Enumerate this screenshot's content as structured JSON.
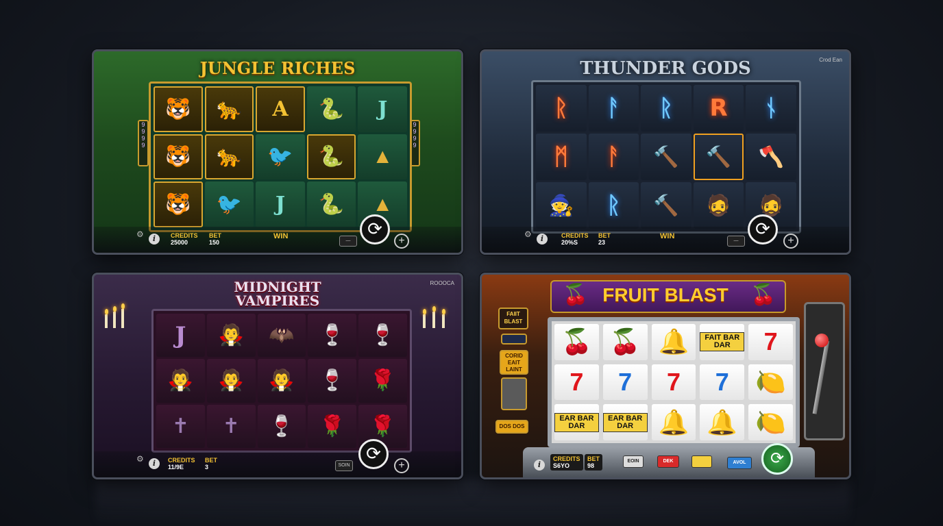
{
  "games": [
    {
      "title": "JUNGLE RICHES",
      "credits_label": "CREDITS",
      "credits_value": "25000",
      "bet_label": "BET",
      "bet_value": "150",
      "win_label": "WIN",
      "reels": [
        [
          "🐯",
          "🐆",
          "A",
          "🐍",
          "J"
        ],
        [
          "🐯",
          "🐆",
          "🐦",
          "🐍",
          "▲"
        ],
        [
          "🐯",
          "🐦",
          "J",
          "🐍",
          "▲"
        ]
      ],
      "paylines": "9\n9\n9\n9"
    },
    {
      "title": "THUNDER GODS",
      "corner_tag": "Crod Ean",
      "credits_label": "CREDITS",
      "credits_value": "20%S",
      "bet_label": "BET",
      "bet_value": "23",
      "win_label": "WIN",
      "reels": [
        [
          "ᚱ",
          "ᚨ",
          "ᚱ",
          "R",
          "ᚾ"
        ],
        [
          "ᛗ",
          "ᚨ",
          "🔨",
          "🔨",
          "🪓"
        ],
        [
          "🧙",
          "ᚱ",
          "🔨",
          "🧔",
          "🧔"
        ]
      ]
    },
    {
      "title_line1": "MIDNIGHT",
      "title_line2": "VAMPIRES",
      "corner_tag": "ROOOCA",
      "credits_label": "CREDITS",
      "credits_value": "11/9E",
      "bet_label": "BET",
      "bet_value": "3",
      "minus_label": "SOIN",
      "reels": [
        [
          "J",
          "🧛",
          "🦇",
          "🍷",
          "🍷"
        ],
        [
          "🧛",
          "🧛",
          "🧛",
          "🍷",
          "🌹"
        ],
        [
          "✝",
          "✝",
          "🍷",
          "🌹",
          "🌹"
        ]
      ]
    },
    {
      "title": "FRUIT BLAST",
      "side_logo": "FAIIT BLAST",
      "side_box_1": "CORID EAIT LAINT",
      "side_box_2": "DOS DOS",
      "credits_label": "CREDITS",
      "credits_value": "S6YO",
      "bet_label": "BET",
      "bet_value": "98",
      "btn_1": "EOIN",
      "btn_2": "DEK",
      "btn_3": "",
      "btn_4": "AVOL",
      "reels": [
        [
          "🍒",
          "🍒",
          "🔔",
          "FAIT BAR DAR",
          "7"
        ],
        [
          "7",
          "7",
          "7",
          "7",
          "🍋"
        ],
        [
          "EAR BAR DAR",
          "EAR BAR DAR",
          "🔔",
          "🔔",
          "🍋"
        ]
      ],
      "colors": {
        "seven_red": "#e0161c",
        "seven_blue": "#1e6fd8"
      }
    }
  ]
}
